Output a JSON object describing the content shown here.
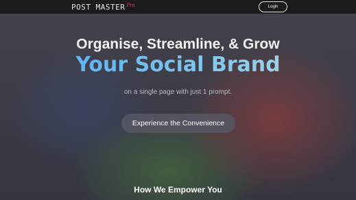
{
  "navbar": {
    "logo_text": "POST MASTER",
    "logo_script": "Pro",
    "login_label": "Login"
  },
  "hero": {
    "subtitle": "Organise, Streamline, & Grow",
    "title": "Your Social Brand",
    "tagline": "on a single page with just 1 prompt.",
    "cta_label": "Experience the Convenience"
  },
  "section": {
    "heading": "How We Empower You"
  },
  "colors": {
    "navbar_bg": "#1c1c1f",
    "title_gradient_start": "#5fb3f0",
    "title_gradient_end": "#9ad3e8",
    "logo_accent": "#d63a6a"
  }
}
